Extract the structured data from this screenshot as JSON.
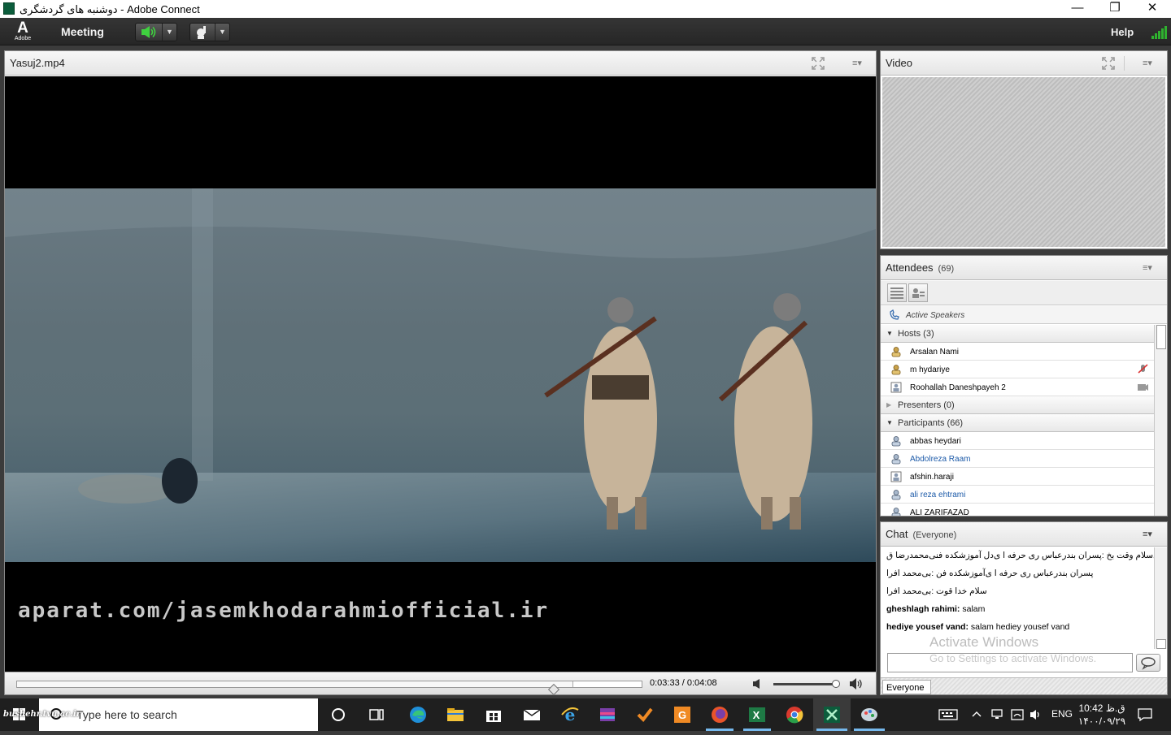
{
  "window": {
    "title": "دوشنبه های گردشگری - Adobe Connect",
    "minimize": "—",
    "restore": "❐",
    "close": "✕"
  },
  "menubar": {
    "adobe_logo_letter": "A",
    "adobe_logo_text": "Adobe",
    "meeting": "Meeting",
    "help": "Help"
  },
  "share_pod": {
    "title": "Yasuj2.mp4",
    "watermark": "aparat.com/jasemkhodarahmiofficial.ir",
    "time": "0:03:33 / 0:04:08",
    "progress": 0.86,
    "volume": 1.0
  },
  "video_pod": {
    "title": "Video"
  },
  "attendees": {
    "title": "Attendees",
    "count": "(69)",
    "active_speakers": "Active Speakers",
    "hosts_label": "Hosts (3)",
    "hosts": [
      {
        "name": "Arsalan  Nami",
        "blue": false
      },
      {
        "name": "m hydariye",
        "blue": false
      },
      {
        "name": "Roohallah Daneshpayeh 2",
        "blue": false
      }
    ],
    "presenters_label": "Presenters (0)",
    "participants_label": "Participants (66)",
    "participants": [
      {
        "name": "abbas heydari",
        "blue": false
      },
      {
        "name": "Abdolreza Raam",
        "blue": true
      },
      {
        "name": "afshin.haraji",
        "blue": false
      },
      {
        "name": "ali reza ehtrami",
        "blue": true
      },
      {
        "name": "ALI ZARIFAZAD",
        "blue": false
      }
    ]
  },
  "chat": {
    "title": "Chat",
    "scope": "(Everyone)",
    "messages": [
      {
        "sender": "",
        "text": "ری‌سلام وقت بخ :پسران بندرعباس ری حرفه ا ی‌دل آموزشکده فنی‌محمدرضا ق"
      },
      {
        "sender": "",
        "text": "پسران بندرعباس ری حرفه ا ی‌آموزشکده فن :بی‌محمد افرا"
      },
      {
        "sender": "",
        "text": "سلام خدا قوت :بی‌محمد افرا"
      },
      {
        "sender": "gheshlagh  rahimi:",
        "text": " salam"
      },
      {
        "sender": "hediye yousef vand:",
        "text": " salam hediey yousef vand"
      }
    ],
    "activate_title": "Activate Windows",
    "activate_sub": "Go to Settings to activate Windows.",
    "everyone": "Everyone"
  },
  "taskbar": {
    "bushehr": "bushehr.tvu.ac.ir",
    "search_placeholder": "Type here to search",
    "lang": "ENG",
    "time": "10:42 ق.ظ",
    "date": "۱۴۰۰/۰۹/۲۹"
  },
  "colors": {
    "menubar": "#2d2d2d",
    "accent_green": "#2fb12f",
    "link_blue": "#1c5aa8"
  }
}
